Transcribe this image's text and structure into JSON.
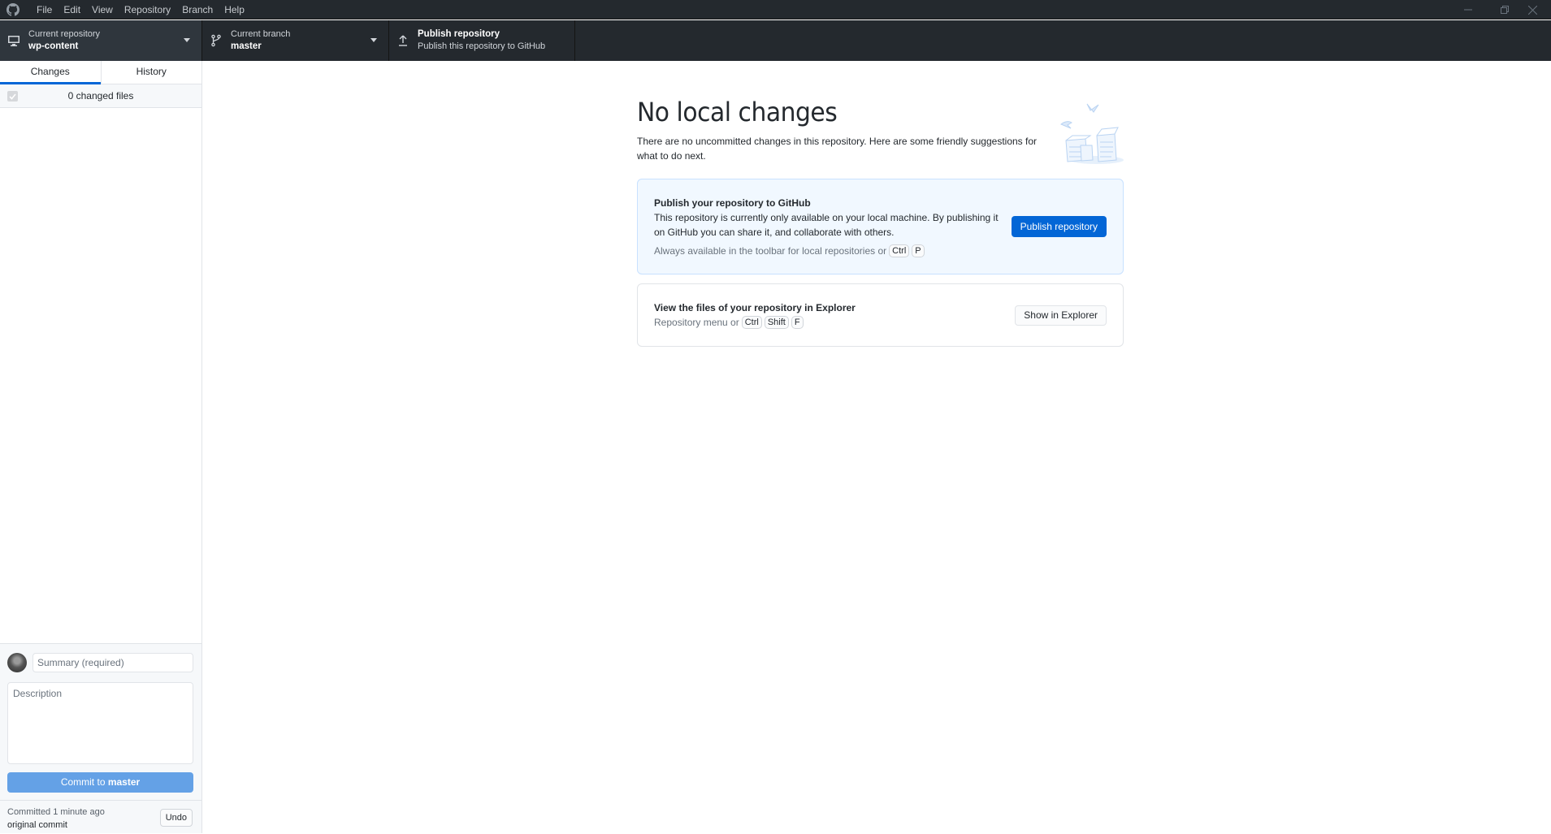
{
  "menubar": {
    "items": [
      "File",
      "Edit",
      "View",
      "Repository",
      "Branch",
      "Help"
    ]
  },
  "toolbar": {
    "repository": {
      "label": "Current repository",
      "value": "wp-content"
    },
    "branch": {
      "label": "Current branch",
      "value": "master"
    },
    "publish": {
      "label": "Publish repository",
      "description": "Publish this repository to GitHub"
    }
  },
  "sidebar": {
    "tabs": [
      {
        "label": "Changes",
        "active": true
      },
      {
        "label": "History",
        "active": false
      }
    ],
    "changed_files": "0 changed files",
    "commit": {
      "summary_placeholder": "Summary (required)",
      "description_placeholder": "Description",
      "button_prefix": "Commit to ",
      "button_branch": "master"
    },
    "last_commit": {
      "when": "Committed 1 minute ago",
      "message": "original commit",
      "undo_label": "Undo"
    }
  },
  "main": {
    "heading": "No local changes",
    "subtitle": "There are no uncommitted changes in this repository. Here are some friendly suggestions for what to do next.",
    "publish_card": {
      "title": "Publish your repository to GitHub",
      "body": "This repository is currently only available on your local machine. By publishing it on GitHub you can share it, and collaborate with others.",
      "hint": "Always available in the toolbar for local repositories or",
      "shortcut": [
        "Ctrl",
        "P"
      ],
      "button": "Publish repository"
    },
    "explorer_card": {
      "title": "View the files of your repository in Explorer",
      "hint": "Repository menu or",
      "shortcut": [
        "Ctrl",
        "Shift",
        "F"
      ],
      "button": "Show in Explorer"
    }
  },
  "colors": {
    "accent": "#0366d6",
    "toolbar_bg": "#24292e",
    "commit_button_disabled": "#64a1e6",
    "publish_card_bg": "#f1f8ff"
  }
}
